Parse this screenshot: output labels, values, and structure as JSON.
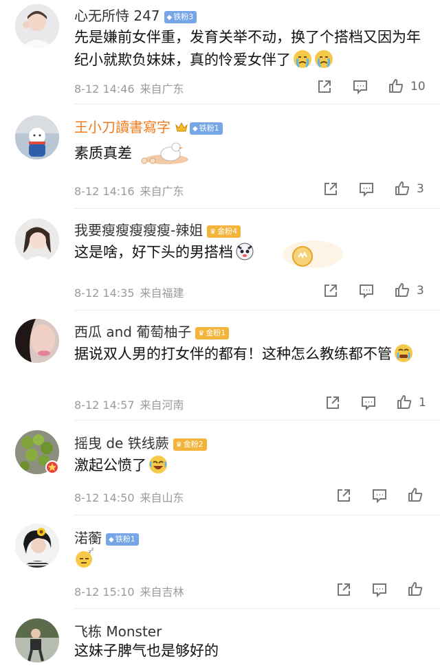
{
  "comments": [
    {
      "username": "心无所恃 247",
      "badge": "铁粉3",
      "text": "先是嫌前女伴重，发育关举不动，换了个搭档又因为年纪小就欺负妹妹，真的怜爱女伴了",
      "time": "8-12 14:46",
      "location": "来自广东",
      "likes": "10"
    },
    {
      "username": "王小刀讀書寫字",
      "badge": "铁粉1",
      "text": "素质真差",
      "time": "8-12 14:16",
      "location": "来自广东",
      "likes": "3"
    },
    {
      "username": "我要瘦瘦瘦瘦瘦-辣姐",
      "badge": "金粉4",
      "text": "这是啥，好下头的男搭档",
      "time": "8-12 14:35",
      "location": "来自福建",
      "likes": "3"
    },
    {
      "username": "西瓜 and 葡萄柚子",
      "badge": "金粉1",
      "text": "据说双人男的打女伴的都有！这种怎么教练都不管",
      "time": "8-12 14:57",
      "location": "来自河南",
      "likes": "1"
    },
    {
      "username": "摇曳 de 铁线蕨",
      "badge": "金粉2",
      "text": "激起公愤了",
      "time": "8-12 14:50",
      "location": "来自山东",
      "likes": ""
    },
    {
      "username": "渃蘅",
      "badge": "铁粉1",
      "text": "",
      "time": "8-12 15:10",
      "location": "来自吉林",
      "likes": ""
    },
    {
      "username": "飞栋 Monster",
      "badge": "",
      "text": "这妹子脾气也是够好的",
      "time": "",
      "location": "",
      "likes": ""
    }
  ],
  "icons": {
    "share": "share-icon",
    "comment": "comment-icon",
    "like": "thumbs-up-icon"
  },
  "colors": {
    "vip_name": "#f27a1a",
    "iron_badge": "#76a6e6",
    "gold_badge": "#f2b43b",
    "meta": "#9a9a9a"
  }
}
